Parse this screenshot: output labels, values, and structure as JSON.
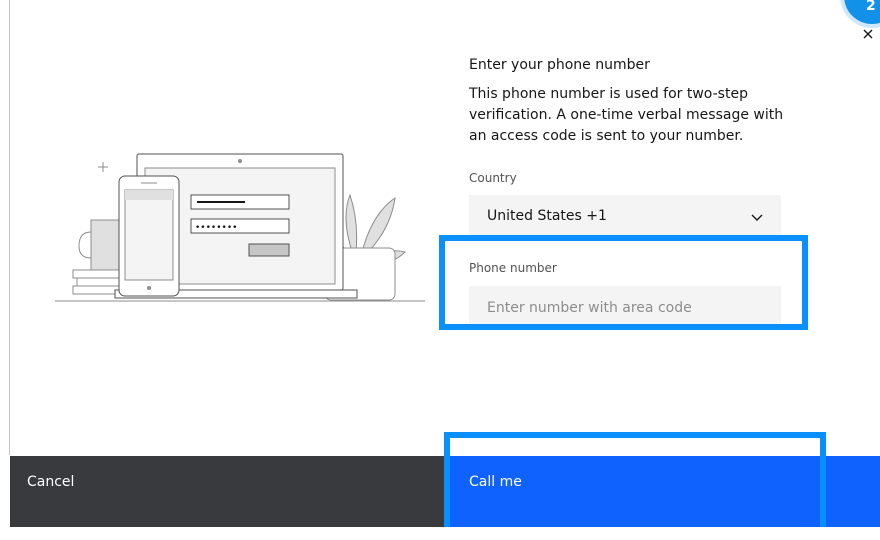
{
  "dialog": {
    "heading": "Enter your phone number",
    "description": "This phone number is used for two-step verification. A one-time verbal message with an access code is sent to your number.",
    "country_label": "Country",
    "country_value": "United States +1",
    "phone_label": "Phone number",
    "phone_placeholder": "Enter number with area code",
    "phone_value": "",
    "cancel_label": "Cancel",
    "call_label": "Call me",
    "close_symbol": "×",
    "step_badge": "2"
  },
  "colors": {
    "primary_button": "#0f62fe",
    "secondary_button": "#393a3d",
    "highlight": "#0a8fff",
    "field_background": "#f4f4f4"
  },
  "icons": [
    "chevron-down-icon",
    "close-icon",
    "laptop-phone-illustration"
  ]
}
